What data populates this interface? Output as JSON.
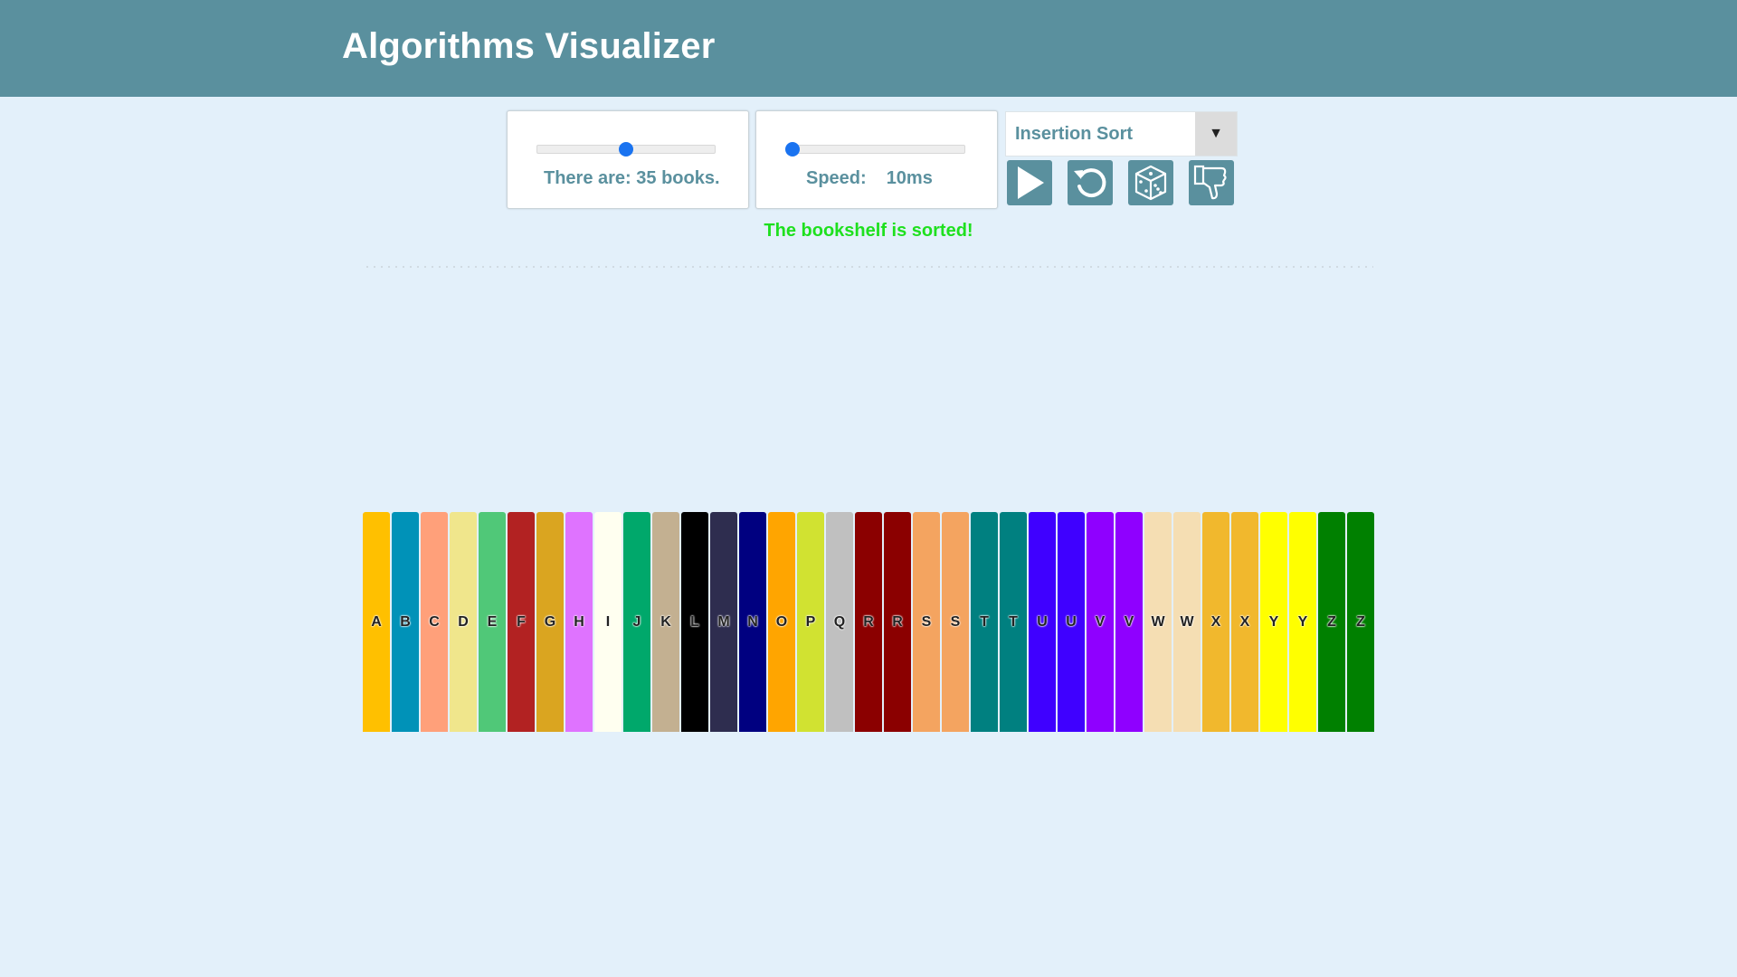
{
  "app": {
    "title": "Algorithms Visualizer"
  },
  "controls": {
    "books_label": "There are: 35 books.",
    "books_count": 35,
    "speed_label": "Speed:",
    "speed_value": "10ms",
    "algorithm_selected": "Insertion Sort",
    "dropdown_arrow": "▼",
    "buttons": [
      "play-icon",
      "reset-icon",
      "dice-icon",
      "thumbs-down-icon"
    ]
  },
  "status": {
    "message": "The bookshelf is sorted!",
    "color": "#1ee01e"
  },
  "books": [
    {
      "letter": "A",
      "color": "#ffc000"
    },
    {
      "letter": "B",
      "color": "#0092b8"
    },
    {
      "letter": "C",
      "color": "#ffa07a"
    },
    {
      "letter": "D",
      "color": "#f0e68c"
    },
    {
      "letter": "E",
      "color": "#50c878"
    },
    {
      "letter": "F",
      "color": "#b22222"
    },
    {
      "letter": "G",
      "color": "#daa520"
    },
    {
      "letter": "H",
      "color": "#df73ff"
    },
    {
      "letter": "I",
      "color": "#fffff0"
    },
    {
      "letter": "J",
      "color": "#00a86b"
    },
    {
      "letter": "K",
      "color": "#c3b091"
    },
    {
      "letter": "L",
      "color": "#000000"
    },
    {
      "letter": "M",
      "color": "#2e2d4f"
    },
    {
      "letter": "N",
      "color": "#000080"
    },
    {
      "letter": "O",
      "color": "#ffa500"
    },
    {
      "letter": "P",
      "color": "#d1e231"
    },
    {
      "letter": "Q",
      "color": "#c0c0c0"
    },
    {
      "letter": "R",
      "color": "#8b0000"
    },
    {
      "letter": "R",
      "color": "#8b0000"
    },
    {
      "letter": "S",
      "color": "#f4a460"
    },
    {
      "letter": "S",
      "color": "#f4a460"
    },
    {
      "letter": "T",
      "color": "#008080"
    },
    {
      "letter": "T",
      "color": "#008080"
    },
    {
      "letter": "U",
      "color": "#3f00ff"
    },
    {
      "letter": "U",
      "color": "#3f00ff"
    },
    {
      "letter": "V",
      "color": "#8f00ff"
    },
    {
      "letter": "V",
      "color": "#8f00ff"
    },
    {
      "letter": "W",
      "color": "#f5deb3"
    },
    {
      "letter": "W",
      "color": "#f5deb3"
    },
    {
      "letter": "X",
      "color": "#f1b82d"
    },
    {
      "letter": "X",
      "color": "#f1b82d"
    },
    {
      "letter": "Y",
      "color": "#ffff00"
    },
    {
      "letter": "Y",
      "color": "#ffff00"
    },
    {
      "letter": "Z",
      "color": "#008000"
    },
    {
      "letter": "Z",
      "color": "#008000"
    }
  ],
  "theme": {
    "header_bg": "#5a909e",
    "page_bg": "#e3f0fa",
    "accent": "#1a73f0"
  }
}
